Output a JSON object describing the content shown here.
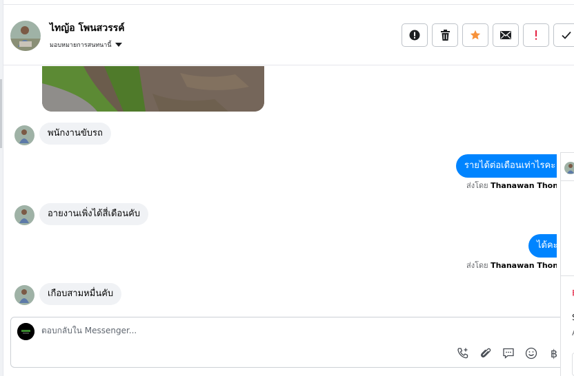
{
  "header": {
    "contact_name": "ไทญ้อ โพนสวรรค์",
    "assign_label": "มอบหมายการสนทนานี้"
  },
  "actions": [
    {
      "name": "report-button",
      "icon": "alert-circle-icon"
    },
    {
      "name": "delete-button",
      "icon": "trash-icon"
    },
    {
      "name": "star-button",
      "icon": "star-icon",
      "color": "#f7923b"
    },
    {
      "name": "mark-unread-button",
      "icon": "envelope-icon"
    },
    {
      "name": "important-button",
      "icon": "exclamation-icon",
      "color": "#e41e3f"
    },
    {
      "name": "done-button",
      "icon": "check-icon"
    }
  ],
  "messages": [
    {
      "direction": "in",
      "text": "พนักงานขับรถ"
    },
    {
      "direction": "out",
      "text": "รายได้ต่อเดือนเท่าไรคะ",
      "sent_by_label": "ส่งโดย",
      "sender": "Thanawan Thon"
    },
    {
      "direction": "in",
      "text": "อายงานเพิ่งได้สี่เดือนคับ"
    },
    {
      "direction": "out",
      "text": "ได้คะ",
      "sent_by_label": "ส่งโดย",
      "sender": "Thanawan Thon"
    },
    {
      "direction": "in",
      "text": "เกือบสามหมื่นคับ"
    }
  ],
  "right_panel": {
    "text_s": "S",
    "text_a": "A"
  },
  "composer": {
    "placeholder": "ตอบกลับใน Messenger..."
  },
  "colors": {
    "accent": "#0084ff",
    "bubble_in": "#f0f2f5",
    "star": "#f7923b",
    "important": "#e41e3f"
  }
}
